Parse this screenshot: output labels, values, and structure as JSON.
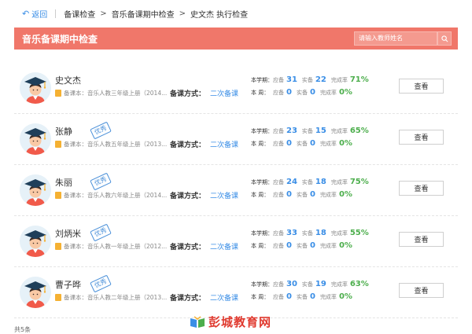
{
  "breadcrumb": {
    "back": "返回",
    "items": [
      "备课检查",
      "音乐备课期中检查",
      "史文杰 执行检查"
    ]
  },
  "header": {
    "title": "音乐备课期中检查",
    "search_placeholder": "请输入教师姓名"
  },
  "labels": {
    "textbook_prefix": "备课本：",
    "method": "备课方式：",
    "term": "本学期：",
    "week": "本  周：",
    "due": "应备",
    "actual": "实备",
    "rate": "完成率",
    "view": "查看"
  },
  "teachers": [
    {
      "name": "史文杰",
      "badge": "",
      "textbook": "音乐人教三年级上册（2014...",
      "method": "二次备课",
      "term_due": "31",
      "term_actual": "22",
      "term_rate": "71%",
      "week_due": "0",
      "week_actual": "0",
      "week_rate": "0%"
    },
    {
      "name": "张静",
      "badge": "优秀",
      "textbook": "音乐人教五年级上册（2013...",
      "method": "二次备课",
      "term_due": "23",
      "term_actual": "15",
      "term_rate": "65%",
      "week_due": "0",
      "week_actual": "0",
      "week_rate": "0%"
    },
    {
      "name": "朱丽",
      "badge": "优秀",
      "textbook": "音乐人教六年级上册（2014...",
      "method": "二次备课",
      "term_due": "24",
      "term_actual": "18",
      "term_rate": "75%",
      "week_due": "0",
      "week_actual": "0",
      "week_rate": "0%"
    },
    {
      "name": "刘炳米",
      "badge": "优秀",
      "textbook": "音乐人教一年级上册（2012...",
      "method": "二次备课",
      "term_due": "33",
      "term_actual": "18",
      "term_rate": "55%",
      "week_due": "0",
      "week_actual": "0",
      "week_rate": "0%"
    },
    {
      "name": "曹子晔",
      "badge": "优秀",
      "textbook": "音乐人教二年级上册（2013...",
      "method": "二次备课",
      "term_due": "30",
      "term_actual": "19",
      "term_rate": "63%",
      "week_due": "0",
      "week_actual": "0",
      "week_rate": "0%"
    }
  ],
  "footer": {
    "total": "共5条"
  },
  "watermark": {
    "text": "彭城教育网"
  },
  "colors": {
    "accent": "#f0776a",
    "link": "#3a8ee6",
    "good": "#4cae4c"
  }
}
